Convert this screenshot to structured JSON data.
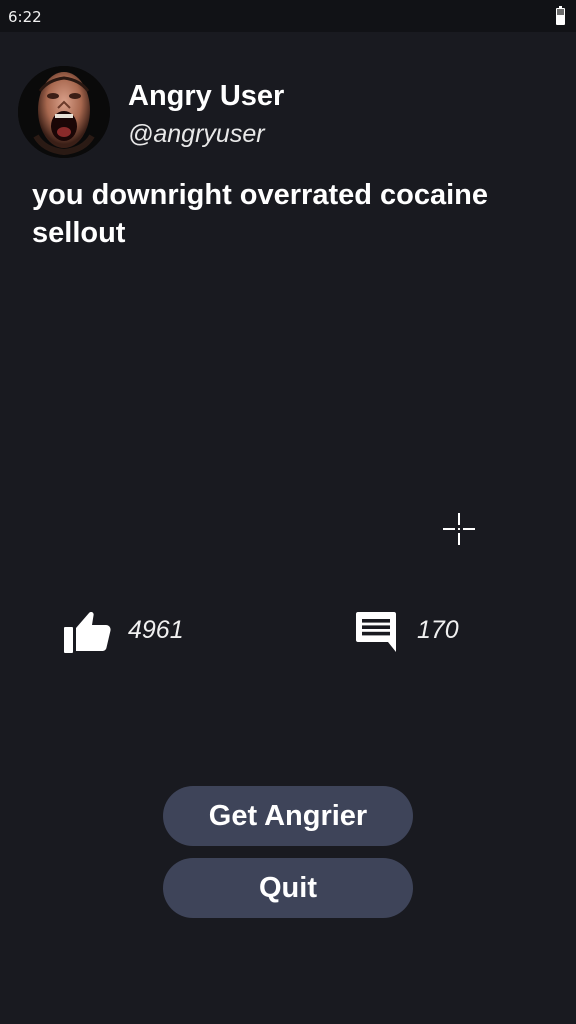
{
  "status_bar": {
    "time": "6:22",
    "battery_icon": "battery-icon"
  },
  "post": {
    "user_name": "Angry User",
    "user_handle": "@angryuser",
    "text": "you downright overrated cocaine sellout",
    "avatar_icon": "avatar-screaming-face",
    "likes": "4961",
    "comments": "170",
    "like_icon": "thumbs-up-icon",
    "comment_icon": "comment-icon"
  },
  "actions": {
    "get_angrier_label": "Get Angrier",
    "quit_label": "Quit"
  },
  "colors": {
    "background": "#191a20",
    "status_bar": "#111216",
    "button": "#3e4459",
    "text": "#ffffff"
  }
}
